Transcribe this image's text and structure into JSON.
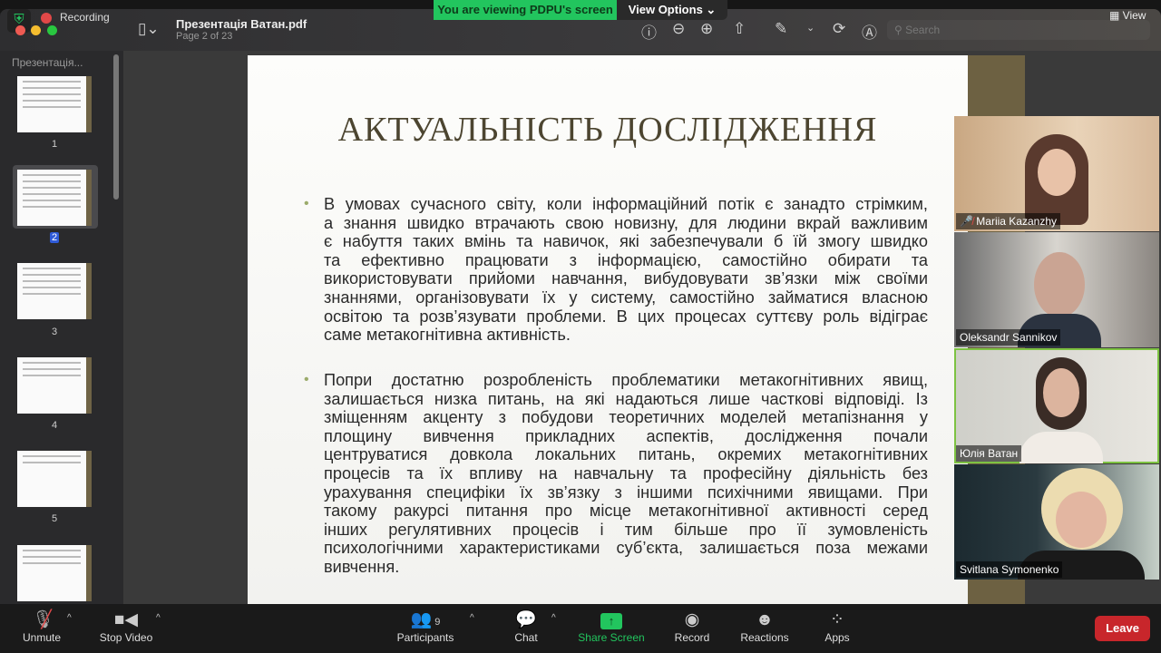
{
  "recording": {
    "label": "Recording"
  },
  "banner": {
    "text": "You are viewing PDPU's screen",
    "view_options": "View Options ⌄"
  },
  "viewer": {
    "file_name": "Презентація Ватан.pdf",
    "page_info": "Page 2 of 23",
    "search_placeholder": "Search",
    "view_label": "View"
  },
  "sidebar": {
    "title": "Презентація...",
    "pages": [
      "1",
      "2",
      "3",
      "4",
      "5"
    ],
    "selected_page": "2"
  },
  "slide": {
    "title": "АКТУАЛЬНІСТЬ ДОСЛІДЖЕННЯ",
    "paragraphs": [
      [
        "В умовах сучасного світу, коли інформаційний потік є занадто стрімким,",
        "а знання швидко втрачають свою новизну, для людини вкрай важливим",
        "є набуття таких вмінь та навичок, які забезпечували б їй змогу швидко",
        "та ефективно працювати з інформацією, самостійно обирати та",
        "використовувати прийоми навчання, вибудовувати зв’язки між своїми",
        "знаннями, організовувати їх у систему, самостійно займатися власною",
        "освітою та розв’язувати проблеми. В цих процесах суттєву роль відіграє",
        "саме метакогнітивна активність."
      ],
      [
        "Попри достатню розробленість проблематики метакогнітивних явищ,",
        "залишається низка питань, на які надаються лише часткові відповіді. Із",
        "зміщенням акценту з побудови теоретичних моделей метапізнання у",
        "площину вивчення прикладних аспектів, дослідження почали",
        "центруватися довкола локальних питань, окремих метакогнітивних",
        "процесів та їх впливу на навчальну та професійну діяльність без",
        "урахування специфіки їх зв’язку з іншими психічними явищами. При",
        "такому ракурсі питання про місце метакогнітивної активності серед",
        "інших регулятивних процесів і тим більше про її зумовленість",
        "психологічними характеристиками суб’єкта, залишається поза межами",
        "вивчення."
      ]
    ]
  },
  "participants": [
    {
      "name": "Mariia Kazanzhy",
      "muted": true
    },
    {
      "name": "Oleksandr Sannikov",
      "muted": false
    },
    {
      "name": "Юлія Ватан",
      "muted": false
    },
    {
      "name": "Svitlana Symonenko",
      "muted": false
    }
  ],
  "controls": {
    "unmute": "Unmute",
    "stop_video": "Stop Video",
    "participants": "Participants",
    "participants_count": "9",
    "chat": "Chat",
    "share_screen": "Share Screen",
    "record": "Record",
    "reactions": "Reactions",
    "apps": "Apps",
    "leave": "Leave"
  },
  "colors": {
    "share_green": "#22c55e",
    "leave_red": "#c8262b",
    "active_speaker": "#7dc242"
  }
}
